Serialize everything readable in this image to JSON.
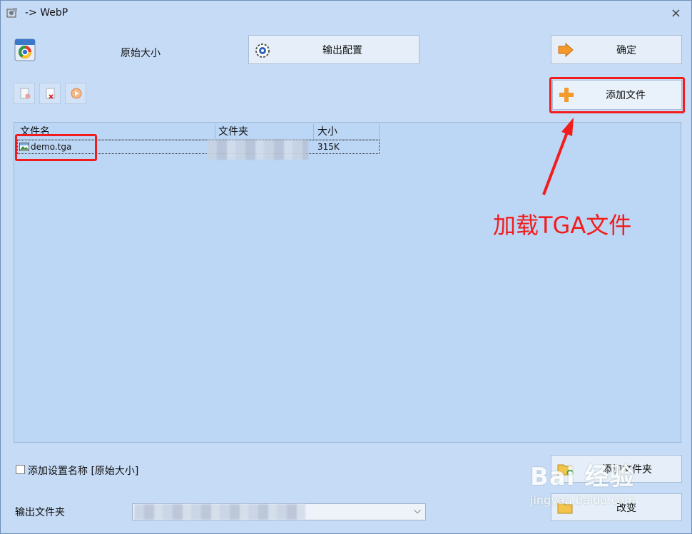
{
  "window": {
    "title": "-> WebP",
    "close_glyph": "×"
  },
  "header": {
    "size_label": "原始大小",
    "output_config_label": "输出配置",
    "confirm_label": "确定",
    "add_file_label": "添加文件"
  },
  "toolbar": {
    "icons": [
      "clear-list-icon",
      "remove-file-icon",
      "play-icon"
    ]
  },
  "list": {
    "columns": [
      "文件名",
      "文件夹",
      "大小"
    ],
    "rows": [
      {
        "filename": "demo.tga",
        "folder": "",
        "size": "315K"
      }
    ]
  },
  "options": {
    "add_settings_label": "添加设置名称 [原始大小]",
    "add_settings_checked": false
  },
  "footer": {
    "add_folder_label": "添加文件夹",
    "output_folder_label": "输出文件夹",
    "change_label": "改变",
    "combo_arrow": "⌵"
  },
  "annotation": {
    "text": "加载TGA文件",
    "color": "#f21c1c"
  },
  "watermark": {
    "brand": "Bai 经验",
    "url": "jingyan.baidu.com"
  }
}
